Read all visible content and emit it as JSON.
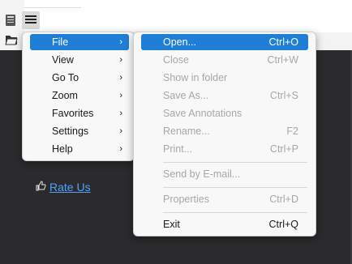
{
  "toolbar": {
    "app_icon": "document-icon",
    "menu_icon": "hamburger-icon",
    "open_icon": "folder-open-icon"
  },
  "viewer": {
    "rate_icon": "thumbs-up-icon",
    "rate_label": "Rate Us"
  },
  "main_menu": {
    "items": [
      {
        "label": "File",
        "selected": true
      },
      {
        "label": "View"
      },
      {
        "label": "Go To"
      },
      {
        "label": "Zoom"
      },
      {
        "label": "Favorites"
      },
      {
        "label": "Settings"
      },
      {
        "label": "Help"
      }
    ]
  },
  "file_menu": {
    "items": [
      {
        "label": "Open...",
        "shortcut": "Ctrl+O",
        "selected": true,
        "enabled": true
      },
      {
        "label": "Close",
        "shortcut": "Ctrl+W",
        "enabled": false
      },
      {
        "label": "Show in folder",
        "shortcut": "",
        "enabled": false
      },
      {
        "label": "Save As...",
        "shortcut": "Ctrl+S",
        "enabled": false
      },
      {
        "label": "Save Annotations",
        "shortcut": "",
        "enabled": false
      },
      {
        "label": "Rename...",
        "shortcut": "F2",
        "enabled": false
      },
      {
        "label": "Print...",
        "shortcut": "Ctrl+P",
        "enabled": false
      },
      {
        "label": "Send by E-mail...",
        "shortcut": "",
        "enabled": false
      },
      {
        "label": "Properties",
        "shortcut": "Ctrl+D",
        "enabled": false
      },
      {
        "label": "Exit",
        "shortcut": "Ctrl+Q",
        "enabled": true
      }
    ]
  },
  "colors": {
    "accent": "#1f7ed6",
    "viewer_bg": "#2b2b2d",
    "link": "#4ea3ff",
    "disabled_text": "#a7a7a7"
  }
}
